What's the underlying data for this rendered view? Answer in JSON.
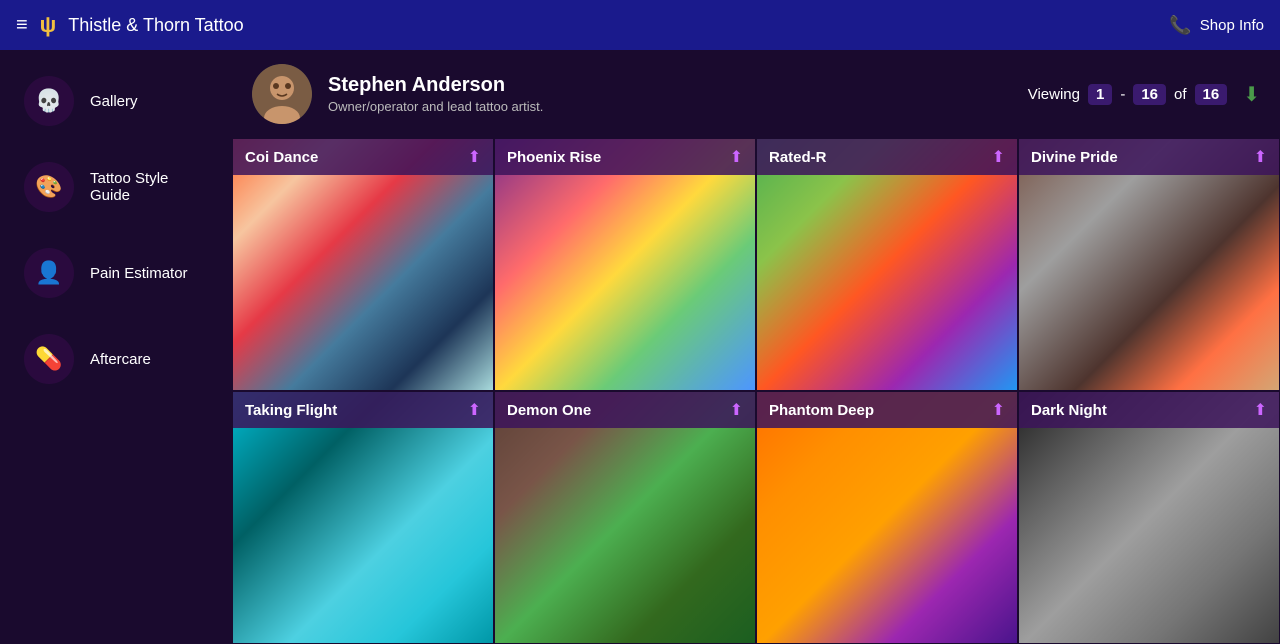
{
  "topNav": {
    "hamburger": "≡",
    "logo": "ψ",
    "brandName": "Thistle & Thorn Tattoo",
    "phoneIcon": "📞",
    "shopInfoLabel": "Shop Info"
  },
  "sidebar": {
    "items": [
      {
        "id": "gallery",
        "label": "Gallery",
        "icon": "💀"
      },
      {
        "id": "style-guide",
        "label": "Tattoo Style Guide",
        "icon": "🎨"
      },
      {
        "id": "pain-estimator",
        "label": "Pain Estimator",
        "icon": "👤"
      },
      {
        "id": "aftercare",
        "label": "Aftercare",
        "icon": "💊"
      }
    ]
  },
  "artistHeader": {
    "avatarIcon": "👤",
    "name": "Stephen Anderson",
    "role": "Owner/operator and lead tattoo artist.",
    "viewingLabel": "Viewing",
    "viewingStart": "1",
    "dash": "-",
    "viewingEnd": "16",
    "ofLabel": "of",
    "total": "16",
    "downloadIcon": "⬇"
  },
  "gallery": {
    "items": [
      {
        "id": "coi-dance",
        "title": "Coi Dance",
        "imgClass": "img-coi"
      },
      {
        "id": "phoenix-rise",
        "title": "Phoenix Rise",
        "imgClass": "img-phoenix"
      },
      {
        "id": "rated-r",
        "title": "Rated-R",
        "imgClass": "img-rated-r"
      },
      {
        "id": "divine-pride",
        "title": "Divine Pride",
        "imgClass": "img-divine"
      },
      {
        "id": "taking-flight",
        "title": "Taking Flight",
        "imgClass": "img-taking"
      },
      {
        "id": "demon-one",
        "title": "Demon One",
        "imgClass": "img-demon"
      },
      {
        "id": "phantom-deep",
        "title": "Phantom Deep",
        "imgClass": "img-phantom"
      },
      {
        "id": "dark-night",
        "title": "Dark Night",
        "imgClass": "img-dark"
      }
    ],
    "expandIcon": "⬆"
  }
}
